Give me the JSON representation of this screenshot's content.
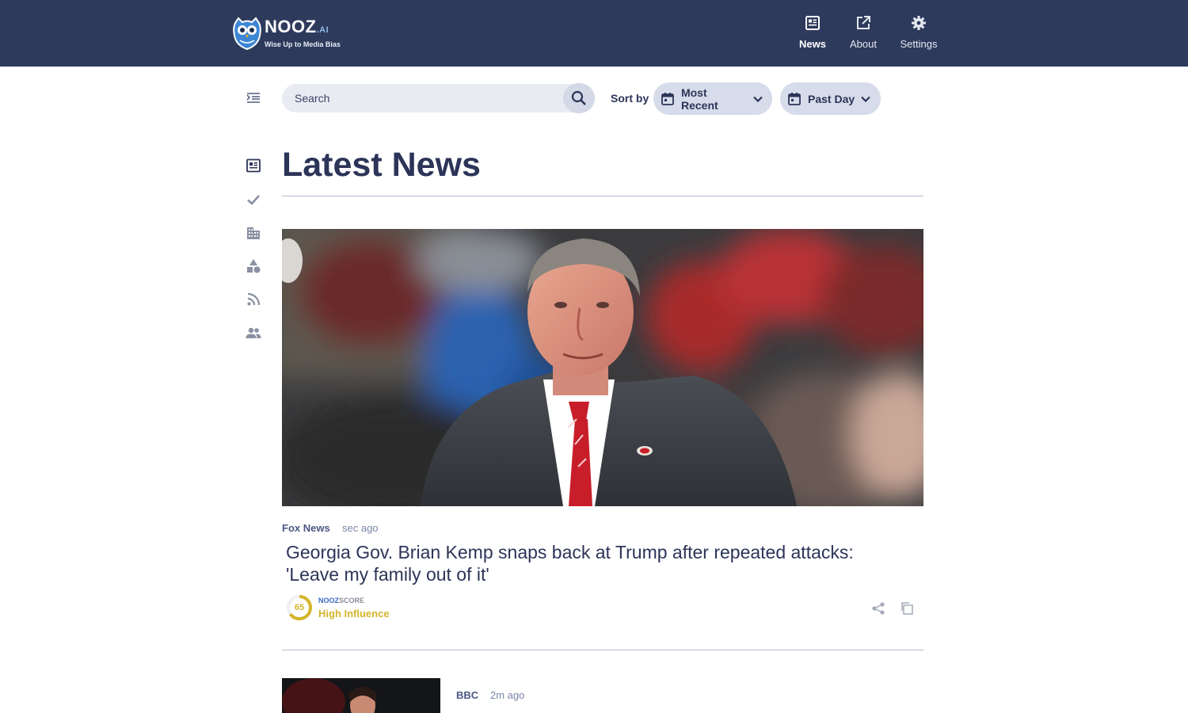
{
  "brand": {
    "name": "NOOZ",
    "suffix": ".AI",
    "tagline": "Wise Up to Media Bias"
  },
  "nav": [
    {
      "label": "News",
      "icon": "newspaper-icon",
      "active": true
    },
    {
      "label": "About",
      "icon": "external-link-icon",
      "active": false
    },
    {
      "label": "Settings",
      "icon": "gear-icon",
      "active": false
    }
  ],
  "sidebar": {
    "toggle_icon": "menu-indent-icon",
    "items": [
      {
        "icon": "newspaper-icon",
        "active": true
      },
      {
        "icon": "checkmark-icon",
        "active": false
      },
      {
        "icon": "building-icon",
        "active": false
      },
      {
        "icon": "shapes-icon",
        "active": false
      },
      {
        "icon": "rss-icon",
        "active": false
      },
      {
        "icon": "people-icon",
        "active": false
      }
    ]
  },
  "toolbar": {
    "search_placeholder": "Search",
    "sort_label": "Sort by",
    "sort_value": "Most Recent",
    "date_value": "Past Day"
  },
  "page": {
    "title": "Latest News"
  },
  "articles": [
    {
      "source": "Fox News",
      "time": "sec ago",
      "headline": "Georgia Gov. Brian Kemp snaps back at Trump after repeated attacks: 'Leave my family out of it'",
      "score": {
        "brand_a": "NOOZ",
        "brand_b": "SCORE",
        "value": "65",
        "fraction": 0.65,
        "label": "High Influence"
      }
    },
    {
      "source": "BBC",
      "time": "2m ago",
      "headline": ""
    }
  ],
  "colors": {
    "header_bg": "#2e3a5c",
    "accent_text": "#2c3458",
    "score": "#d4b52a",
    "pill_bg": "#d6dcea"
  }
}
